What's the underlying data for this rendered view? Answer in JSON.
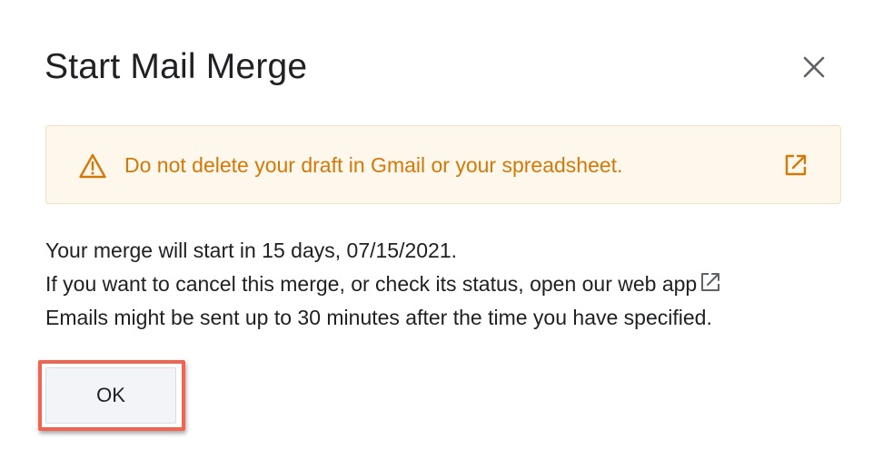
{
  "dialog": {
    "title": "Start Mail Merge",
    "close_icon": "close-icon"
  },
  "warning": {
    "icon": "warning-triangle-icon",
    "text": "Do not delete your draft in Gmail or your spreadsheet.",
    "link_icon": "open-in-new-icon",
    "color": "#d3790a",
    "background": "#fef7ec"
  },
  "body": {
    "line1": "Your merge will start in 15 days, 07/15/2021.",
    "line2": "If you want to cancel this merge, or check its status, open our web app",
    "line2_icon": "open-in-new-icon",
    "line3": "Emails might be sent up to 30 minutes after the time you have specified."
  },
  "actions": {
    "ok_label": "OK",
    "highlight_color": "#f26450"
  }
}
